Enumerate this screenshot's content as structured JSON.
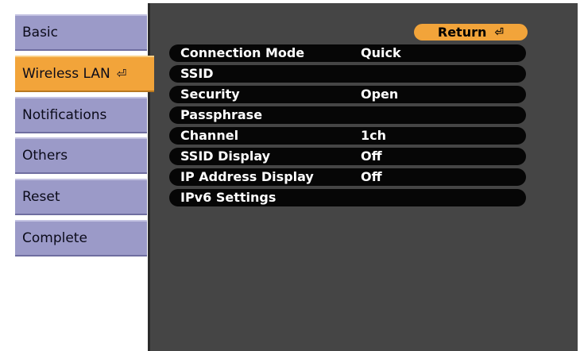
{
  "sidebar": {
    "items": [
      {
        "label": "Basic"
      },
      {
        "label": "Wireless LAN"
      },
      {
        "label": "Notifications"
      },
      {
        "label": "Others"
      },
      {
        "label": "Reset"
      },
      {
        "label": "Complete"
      }
    ],
    "active_index": 1,
    "active_icon": "enter-icon"
  },
  "panel": {
    "return_label": "Return",
    "return_icon": "enter-icon",
    "rows": [
      {
        "label": "Connection Mode",
        "value": "Quick"
      },
      {
        "label": "SSID",
        "value": ""
      },
      {
        "label": "Security",
        "value": "Open"
      },
      {
        "label": "Passphrase",
        "value": ""
      },
      {
        "label": "Channel",
        "value": "1ch"
      },
      {
        "label": "SSID Display",
        "value": "Off"
      },
      {
        "label": "IP Address Display",
        "value": "Off"
      },
      {
        "label": "IPv6 Settings",
        "value": ""
      }
    ]
  },
  "colors": {
    "tab": "#9b9ac8",
    "tab_active": "#f2a43a",
    "panel": "#454545",
    "row": "#060606",
    "row_text": "#ffffff"
  }
}
